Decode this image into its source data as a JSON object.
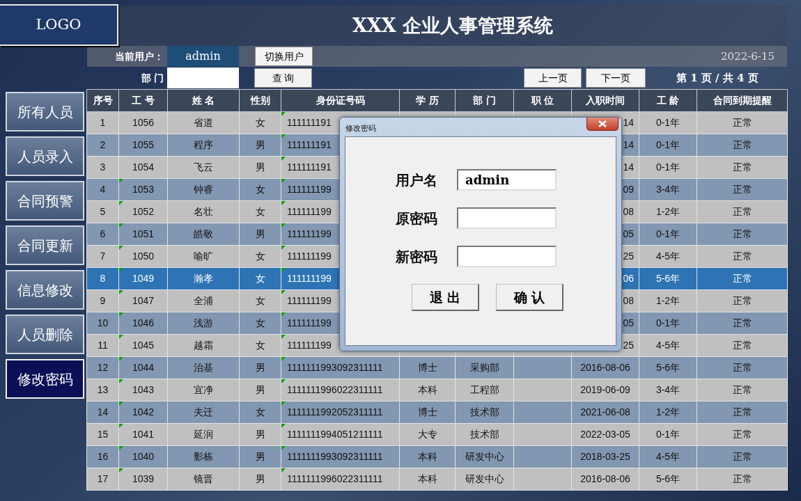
{
  "logo": "LOGO",
  "title": "XXX 企业人事管理系统",
  "toolbar": {
    "user_label": "当前用户：",
    "user": "admin",
    "switch_button": "切换用户",
    "date": "2022-6-15",
    "dept_label": "部 门",
    "search_button": "查 询",
    "prev_button": "上一页",
    "next_button": "下一页",
    "page_info": "第 1 页 / 共 4 页"
  },
  "sidebar": [
    {
      "label": "所有人员",
      "selected": false
    },
    {
      "label": "人员录入",
      "selected": false
    },
    {
      "label": "合同预警",
      "selected": false
    },
    {
      "label": "合同更新",
      "selected": false
    },
    {
      "label": "信息修改",
      "selected": false
    },
    {
      "label": "人员删除",
      "selected": false
    },
    {
      "label": "修改密码",
      "selected": true
    }
  ],
  "table": {
    "columns": [
      "序号",
      "工 号",
      "姓 名",
      "性别",
      "身份证号码",
      "学 历",
      "部 门",
      "职 位",
      "入职时间",
      "工 龄",
      "合同到期提醒"
    ],
    "rows": [
      {
        "selected": false,
        "job_no_marked": false,
        "id_marked": true,
        "no": "1",
        "job_no": "1056",
        "name": "省道",
        "gender": "女",
        "id": "111111191",
        "date": "14",
        "tenure": "0-1年",
        "status": "正常"
      },
      {
        "selected": false,
        "job_no_marked": false,
        "id_marked": true,
        "no": "2",
        "job_no": "1055",
        "name": "程序",
        "gender": "男",
        "id": "111111191",
        "date": "14",
        "tenure": "0-1年",
        "status": "正常"
      },
      {
        "selected": false,
        "job_no_marked": false,
        "id_marked": true,
        "no": "3",
        "job_no": "1054",
        "name": "飞云",
        "gender": "男",
        "id": "111111191",
        "date": "14",
        "tenure": "0-1年",
        "status": "正常"
      },
      {
        "selected": false,
        "job_no_marked": true,
        "id_marked": true,
        "no": "4",
        "job_no": "1053",
        "name": "钟睿",
        "gender": "女",
        "id": "111111199",
        "date": "09",
        "tenure": "3-4年",
        "status": "正常"
      },
      {
        "selected": false,
        "job_no_marked": true,
        "id_marked": true,
        "no": "5",
        "job_no": "1052",
        "name": "名壮",
        "gender": "女",
        "id": "111111199",
        "date": "08",
        "tenure": "1-2年",
        "status": "正常"
      },
      {
        "selected": false,
        "job_no_marked": true,
        "id_marked": true,
        "no": "6",
        "job_no": "1051",
        "name": "皓敬",
        "gender": "男",
        "id": "111111199",
        "date": "05",
        "tenure": "0-1年",
        "status": "正常"
      },
      {
        "selected": false,
        "job_no_marked": true,
        "id_marked": true,
        "no": "7",
        "job_no": "1050",
        "name": "喻旷",
        "gender": "女",
        "id": "111111199",
        "date": "25",
        "tenure": "4-5年",
        "status": "正常"
      },
      {
        "selected": true,
        "job_no_marked": true,
        "id_marked": true,
        "no": "8",
        "job_no": "1049",
        "name": "瀚孝",
        "gender": "女",
        "id": "111111199",
        "date": "06",
        "tenure": "5-6年",
        "status": "正常"
      },
      {
        "selected": false,
        "job_no_marked": true,
        "id_marked": true,
        "no": "9",
        "job_no": "1047",
        "name": "全浦",
        "gender": "女",
        "id": "111111199",
        "date": "08",
        "tenure": "1-2年",
        "status": "正常"
      },
      {
        "selected": false,
        "job_no_marked": true,
        "id_marked": true,
        "no": "10",
        "job_no": "1046",
        "name": "浅游",
        "gender": "女",
        "id": "111111199",
        "date": "05",
        "tenure": "0-1年",
        "status": "正常"
      },
      {
        "selected": false,
        "job_no_marked": true,
        "id_marked": true,
        "no": "11",
        "job_no": "1045",
        "name": "越霜",
        "gender": "女",
        "id": "111111199",
        "date": "25",
        "tenure": "4-5年",
        "status": "正常"
      },
      {
        "selected": false,
        "job_no_marked": true,
        "id_marked": true,
        "no": "12",
        "job_no": "1044",
        "name": "治基",
        "gender": "男",
        "id": "1111111993092311111",
        "education": "博士",
        "dept": "采购部",
        "date": "2016-08-06",
        "tenure": "5-6年",
        "status": "正常"
      },
      {
        "selected": false,
        "job_no_marked": true,
        "id_marked": true,
        "no": "13",
        "job_no": "1043",
        "name": "宜净",
        "gender": "男",
        "id": "1111111996022311111",
        "education": "本科",
        "dept": "工程部",
        "date": "2019-06-09",
        "tenure": "3-4年",
        "status": "正常"
      },
      {
        "selected": false,
        "job_no_marked": true,
        "id_marked": true,
        "no": "14",
        "job_no": "1042",
        "name": "夫迁",
        "gender": "女",
        "id": "1111111992052311111",
        "education": "博士",
        "dept": "技术部",
        "date": "2021-06-08",
        "tenure": "1-2年",
        "status": "正常"
      },
      {
        "selected": false,
        "job_no_marked": true,
        "id_marked": true,
        "no": "15",
        "job_no": "1041",
        "name": "延润",
        "gender": "男",
        "id": "1111111994051211111",
        "education": "大专",
        "dept": "技术部",
        "date": "2022-03-05",
        "tenure": "0-1年",
        "status": "正常"
      },
      {
        "selected": false,
        "job_no_marked": true,
        "id_marked": true,
        "no": "16",
        "job_no": "1040",
        "name": "影栋",
        "gender": "男",
        "id": "1111111993092311111",
        "education": "本科",
        "dept": "研发中心",
        "date": "2018-03-25",
        "tenure": "4-5年",
        "status": "正常"
      },
      {
        "selected": false,
        "job_no_marked": true,
        "id_marked": true,
        "no": "17",
        "job_no": "1039",
        "name": "镜晋",
        "gender": "男",
        "id": "1111111996022311111",
        "education": "本科",
        "dept": "研发中心",
        "date": "2016-08-06",
        "tenure": "5-6年",
        "status": "正常"
      }
    ]
  },
  "dialog": {
    "title": "修改密码",
    "fields": [
      {
        "label": "用户名",
        "value": "admin"
      },
      {
        "label": "原密码"
      },
      {
        "label": "新密码"
      }
    ],
    "buttons": [
      "退 出",
      "确 认"
    ]
  }
}
